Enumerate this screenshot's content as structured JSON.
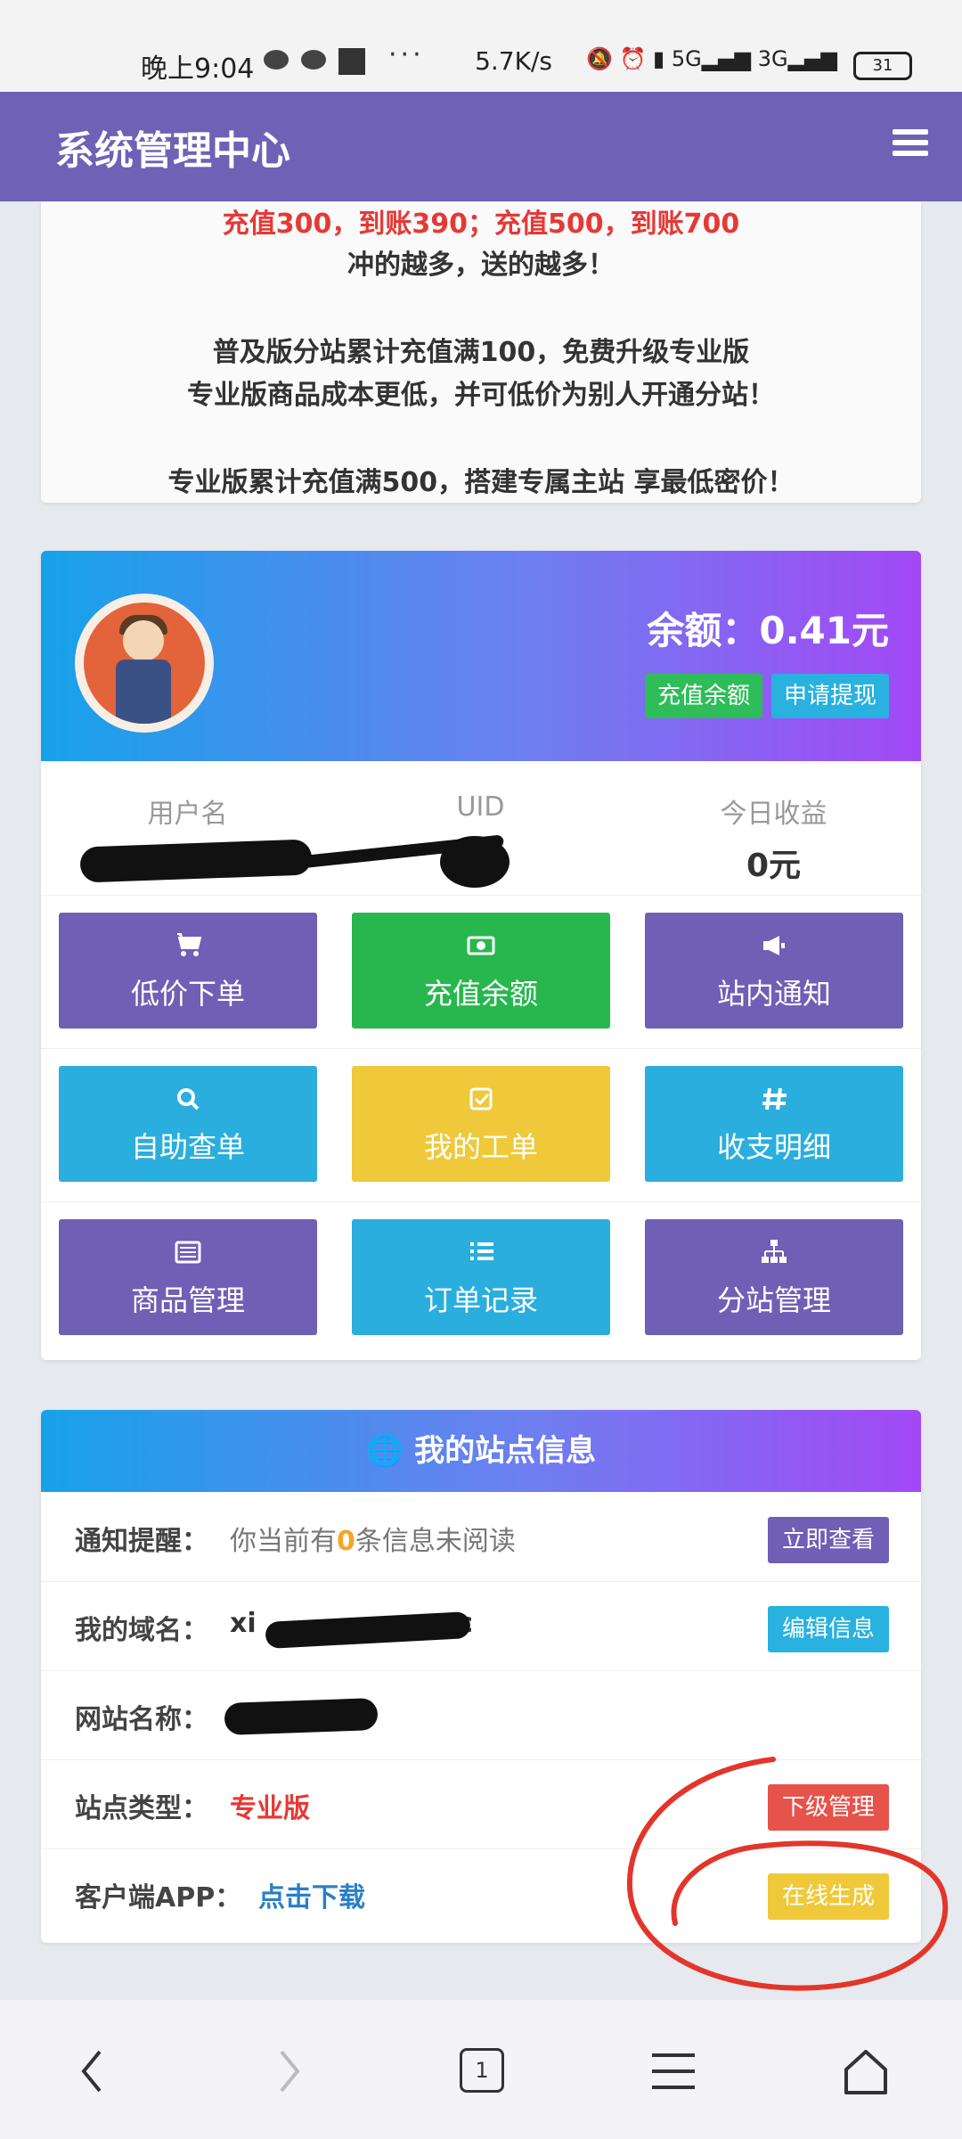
{
  "status_bar": {
    "time": "晚上9:04",
    "right": "5.7K/s",
    "battery": "31"
  },
  "header": {
    "title": "系统管理中心"
  },
  "promo": {
    "line1": "充值300，到账390；充值500，到账700",
    "line2": "冲的越多，送的越多！",
    "line3": "普及版分站累计充值满100，免费升级专业版",
    "line4": "专业版商品成本更低，并可低价为别人开通分站！",
    "line5": "专业版累计充值满500，搭建专属主站 享最低密价！"
  },
  "user": {
    "balance": "余额：0.41元",
    "recharge_btn": "充值余额",
    "withdraw_btn": "申请提现",
    "username_label": "用户名",
    "uid_label": "UID",
    "today_label": "今日收益",
    "today_value": "0元"
  },
  "grid": [
    {
      "label": "低价下单",
      "icon": "cart-icon"
    },
    {
      "label": "充值余额",
      "icon": "money-icon"
    },
    {
      "label": "站内通知",
      "icon": "bullhorn-icon"
    },
    {
      "label": "自助查单",
      "icon": "search-icon"
    },
    {
      "label": "我的工单",
      "icon": "check-square-icon"
    },
    {
      "label": "收支明细",
      "icon": "hash-icon"
    },
    {
      "label": "商品管理",
      "icon": "list-alt-icon"
    },
    {
      "label": "订单记录",
      "icon": "list-icon"
    },
    {
      "label": "分站管理",
      "icon": "sitemap-icon"
    }
  ],
  "site_info": {
    "title": "我的站点信息",
    "notice_label": "通知提醒：",
    "notice_pre": "你当前有",
    "notice_count": "0",
    "notice_post": "条信息未阅读",
    "notice_btn": "立即查看",
    "domain_label": "我的域名：",
    "domain_value": "xi",
    "domain_suffix": ".cc",
    "domain_btn": "编辑信息",
    "name_label": "网站名称：",
    "type_label": "站点类型：",
    "type_value": "专业版",
    "type_btn": "下级管理",
    "app_label": "客户端APP：",
    "app_value": "点击下载",
    "app_btn": "在线生成"
  },
  "nav": {
    "tab_count": "1"
  },
  "colors": {
    "header": "#6f61b6",
    "purple": "#6f5fb5",
    "green": "#28b74f",
    "blue": "#2aaedd",
    "yellow": "#efc93a",
    "red": "#e53935"
  }
}
